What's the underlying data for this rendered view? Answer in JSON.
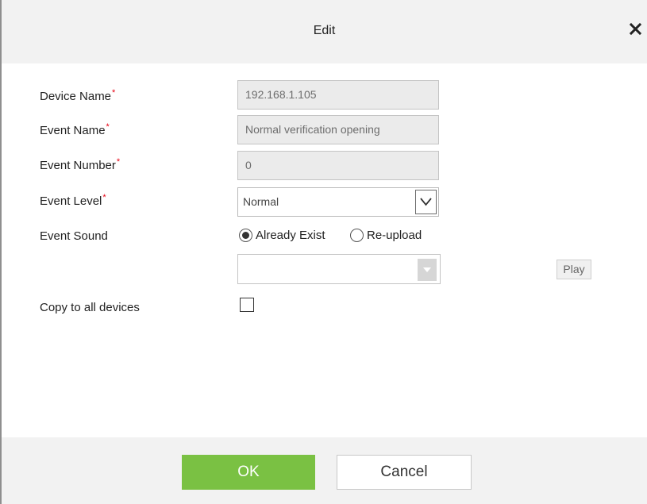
{
  "dialog": {
    "title": "Edit",
    "close_icon": "close-icon"
  },
  "form": {
    "device_name": {
      "label": "Device Name",
      "required_mark": "*",
      "value": "192.168.1.105"
    },
    "event_name": {
      "label": "Event Name",
      "required_mark": "*",
      "value": "Normal verification opening"
    },
    "event_number": {
      "label": "Event Number",
      "required_mark": "*",
      "value": "0"
    },
    "event_level": {
      "label": "Event Level",
      "required_mark": "*",
      "selected": "Normal",
      "arrow_icon": "chevron-down-icon"
    },
    "event_sound": {
      "label": "Event Sound",
      "options": [
        {
          "label": "Already Exist",
          "checked": true
        },
        {
          "label": "Re-upload",
          "checked": false
        }
      ],
      "file_value": "",
      "play_label": "Play"
    },
    "copy_to_all": {
      "label": "Copy to all devices",
      "checked": false
    }
  },
  "footer": {
    "ok_label": "OK",
    "cancel_label": "Cancel"
  },
  "colors": {
    "ok_button": "#7ac143",
    "required": "#e60012",
    "titlebar": "#f2f2f2"
  }
}
